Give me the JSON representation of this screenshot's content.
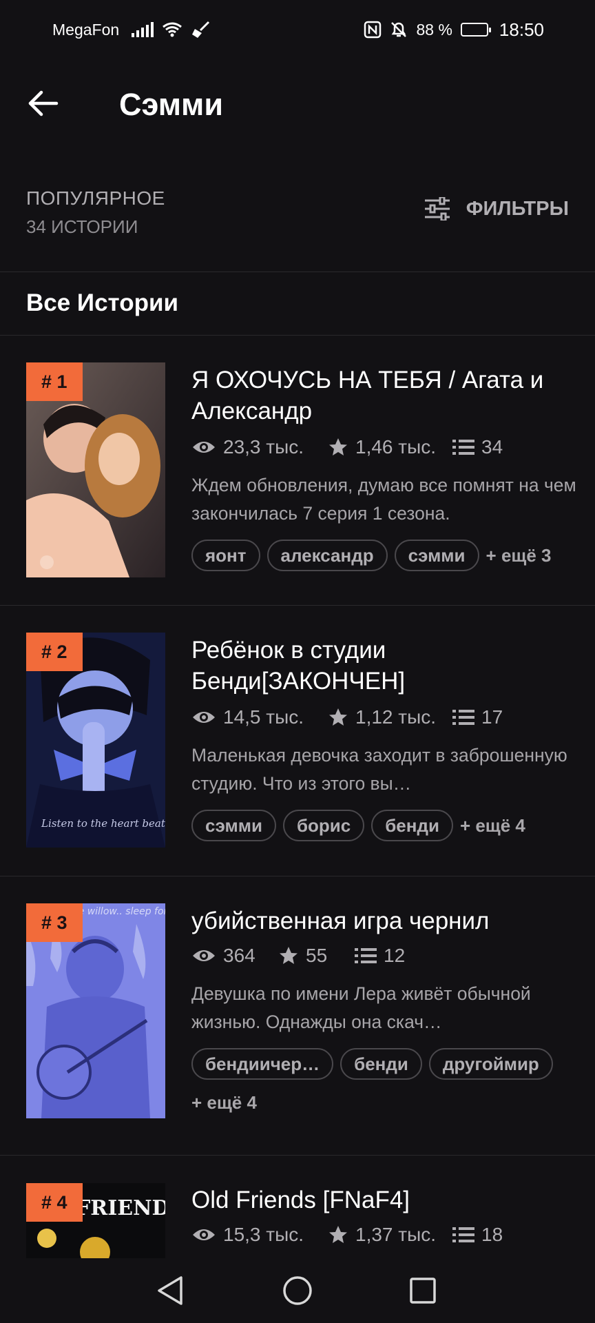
{
  "status_bar": {
    "carrier": "MegaFon",
    "battery": "88 %",
    "time": "18:50",
    "icons": [
      "signal-icon",
      "wifi-icon",
      "broom-icon",
      "nfc-icon",
      "bell-off-icon",
      "battery-icon"
    ]
  },
  "header": {
    "title": "Сэмми",
    "back_icon": "arrow-left-icon"
  },
  "sort": {
    "label": "ПОПУЛЯРНОЕ",
    "count": "34 ИСТОРИИ",
    "filter_label": "ФИЛЬТРЫ",
    "filter_icon": "sliders-icon"
  },
  "section": {
    "title": "Все Истории"
  },
  "stories": [
    {
      "rank": "# 1",
      "title": "Я ОХОЧУСЬ НА ТЕБЯ / Агата и Александр",
      "reads": "23,3 тыс.",
      "votes": "1,46 тыс.",
      "parts": "34",
      "description": "Ждем обновления, думаю все помнят на чем закончилась 7 серия 1 сезона.",
      "tags": [
        "яонт",
        "александр",
        "сэмми"
      ],
      "more": "+ ещё 3"
    },
    {
      "rank": "# 2",
      "title": "Ребёнок в студии Бенди[ЗАКОНЧЕН]",
      "reads": "14,5 тыс.",
      "votes": "1,12 тыс.",
      "parts": "17",
      "description": "Маленькая девочка заходит в заброшенную студию. Что из этого вы…",
      "cover_caption": "Listen to the heart beat",
      "tags": [
        "сэмми",
        "борис",
        "бенди"
      ],
      "more": "+ ещё 4"
    },
    {
      "rank": "# 3",
      "title": "убийственная игра чернил",
      "reads": "364",
      "votes": "55",
      "parts": "12",
      "description": "Девушка по имени Лера живёт обычной жизнью. Однажды она скач…",
      "cover_caption": "me willow.. sleep for me..",
      "tags": [
        "бендиичер…",
        "бенди",
        "другоймир"
      ],
      "more": "+ ещё 4"
    },
    {
      "rank": "# 4",
      "title": "Old Friends [FNaF4]",
      "reads": "15,3 тыс.",
      "votes": "1,37 тыс.",
      "parts": "18",
      "cover_caption": "FRIENDS"
    }
  ],
  "nav": {
    "back_icon": "triangle-back-icon",
    "home_icon": "circle-home-icon",
    "recents_icon": "square-recents-icon"
  },
  "colors": {
    "background": "#121114",
    "accent": "#f26b3a",
    "text_secondary": "#b1afb3",
    "separator": "#2a292c"
  }
}
